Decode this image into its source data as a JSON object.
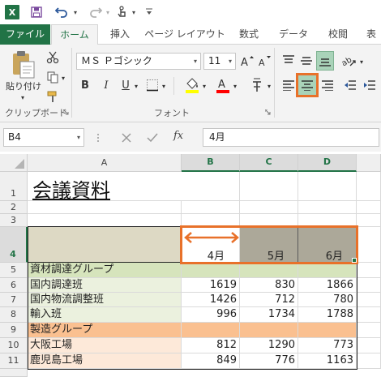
{
  "quick_access": {
    "app_logo": "X",
    "save_icon": "save-icon",
    "undo_icon": "undo-icon",
    "redo_icon": "redo-icon",
    "touch_icon": "touch-mode-icon",
    "dropdown_glyph": "▾"
  },
  "tabs": [
    "ファイル",
    "ホーム",
    "挿入",
    "ページ レイアウト",
    "数式",
    "データ",
    "校閲",
    "表"
  ],
  "ribbon": {
    "clipboard": {
      "paste_label": "貼り付け",
      "group_label": "クリップボード"
    },
    "font": {
      "font_name": "ＭＳ Ｐゴシック",
      "font_size": "11",
      "bold": "B",
      "italic": "I",
      "underline": "U",
      "group_label": "フォント"
    }
  },
  "formula_bar": {
    "name_box": "B4",
    "fx": "fx",
    "value": "4月"
  },
  "sheet": {
    "columns": [
      "A",
      "B",
      "C",
      "D"
    ],
    "rows": [
      "1",
      "2",
      "3",
      "4",
      "5",
      "6",
      "7",
      "8",
      "9",
      "10",
      "11"
    ],
    "title": "会議資料",
    "header_months": [
      "4月",
      "5月",
      "6月"
    ],
    "data_rows": [
      {
        "label": "資材調達グループ",
        "values": [
          "",
          "",
          ""
        ]
      },
      {
        "label": "国内調達班",
        "values": [
          "1619",
          "830",
          "1866"
        ]
      },
      {
        "label": "国内物流調整班",
        "values": [
          "1426",
          "712",
          "780"
        ]
      },
      {
        "label": "輸入班",
        "values": [
          "996",
          "1734",
          "1788"
        ]
      },
      {
        "label": "製造グループ",
        "values": [
          "",
          "",
          ""
        ]
      },
      {
        "label": "大阪工場",
        "values": [
          "812",
          "1290",
          "773"
        ]
      },
      {
        "label": "鹿児島工場",
        "values": [
          "849",
          "776",
          "1163"
        ]
      }
    ]
  },
  "colors": {
    "excel_green": "#217346",
    "highlight_orange": "#e8712a",
    "header_fill": "#ddd9c4",
    "selected_fill": "#aca899",
    "group1_fill": "#d6e4bc",
    "group1_sub_fill": "#ebf1de",
    "group2_fill": "#fac090",
    "group2_sub_fill": "#fde9d9"
  }
}
